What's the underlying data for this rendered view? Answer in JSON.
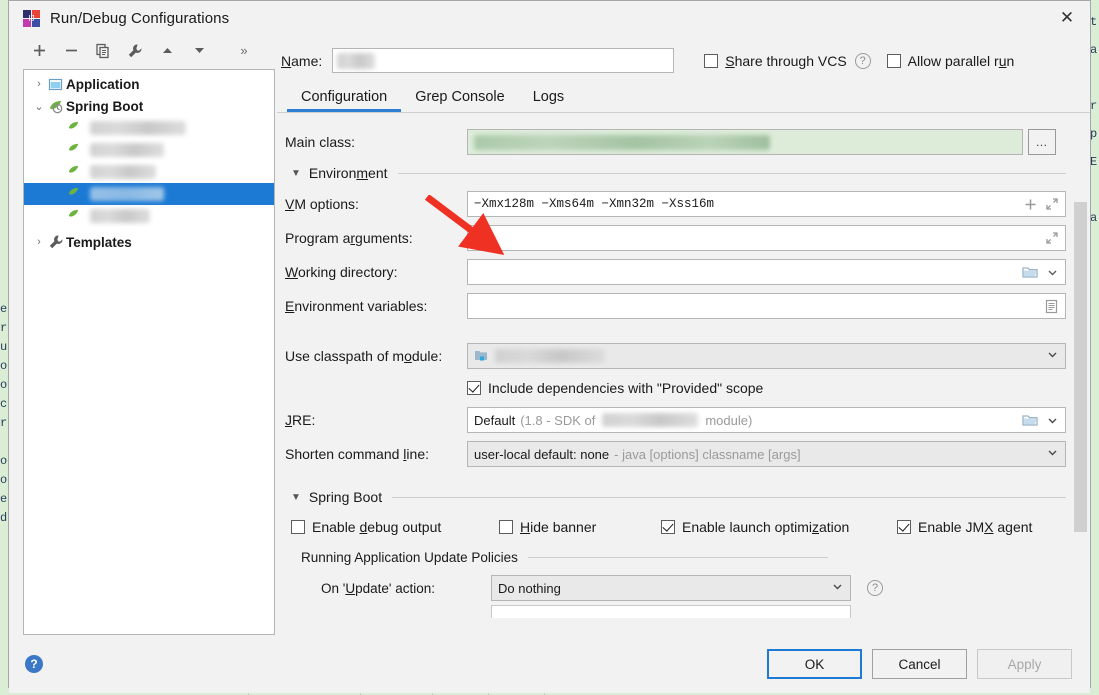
{
  "window": {
    "title": "Run/Debug Configurations",
    "app_icon": "intellij-idea-icon",
    "close_label": "✕"
  },
  "toolbar": {
    "add_label": "+",
    "remove_label": "−",
    "copy_label": "copy-icon",
    "edit_templates_label": "wrench-icon",
    "move_up_label": "▲",
    "move_down_label": "▼",
    "more_label": "»"
  },
  "tree": {
    "groups": [
      {
        "label": "Application",
        "icon": "application-icon",
        "expanded": false,
        "twisty": "›"
      },
      {
        "label": "Spring Boot",
        "icon": "spring-boot-icon",
        "expanded": true,
        "twisty": "⌄"
      },
      {
        "label": "Templates",
        "icon": "wrench-icon",
        "expanded": false,
        "twisty": "›"
      }
    ],
    "children": [
      {
        "redacted": true,
        "selected": false
      },
      {
        "redacted": true,
        "selected": false
      },
      {
        "redacted": true,
        "selected": false
      },
      {
        "redacted": true,
        "selected": true
      },
      {
        "redacted": true,
        "selected": false
      }
    ],
    "selected_index": 3
  },
  "name": {
    "label": "Name:",
    "label_mnemonic": "N",
    "value": "",
    "redacted": true
  },
  "options": {
    "share_vcs_label": "Share through VCS",
    "share_vcs_mnemonic": "S",
    "share_vcs_checked": false,
    "share_vcs_help": "?",
    "allow_parallel_label": "Allow parallel run",
    "allow_parallel_mnemonic": "u",
    "allow_parallel_checked": false
  },
  "tabs": [
    {
      "label": "Configuration",
      "active": true
    },
    {
      "label": "Grep Console",
      "active": false
    },
    {
      "label": "Logs",
      "active": false
    }
  ],
  "form": {
    "main_class": {
      "label": "Main class:",
      "value": "",
      "redacted": true,
      "browse_label": "…"
    },
    "environment_section": {
      "label": "Environment",
      "mnemonic": "m",
      "expanded": true,
      "triangle": "▼"
    },
    "vm_options": {
      "label": "VM options:",
      "mnemonic": "V",
      "value": "−Xmx128m −Xms64m −Xmn32m −Xss16m",
      "add_icon": "plus-icon",
      "expand_icon": "expand-icon"
    },
    "program_arguments": {
      "label": "Program arguments:",
      "mnemonic": "r",
      "value": "",
      "expand_icon": "expand-icon"
    },
    "working_directory": {
      "label": "Working directory:",
      "mnemonic": "W",
      "value": "",
      "browse_icon": "folder-icon",
      "dropdown_icon": "chevron-down-icon"
    },
    "environment_variables": {
      "label": "Environment variables:",
      "mnemonic": "E",
      "value": "",
      "list_icon": "list-icon"
    },
    "classpath_module": {
      "label": "Use classpath of module:",
      "mnemonic": "o",
      "value": "",
      "redacted": true,
      "module_icon": "module-icon",
      "dropdown_icon": "chevron-down-icon"
    },
    "include_provided": {
      "label": "Include dependencies with \"Provided\" scope",
      "checked": true
    },
    "jre": {
      "label": "JRE:",
      "mnemonic": "J",
      "value_strong": "Default",
      "value_detail_prefix": "(1.8 - SDK of",
      "value_detail_suffix": "module)",
      "redacted": true,
      "browse_icon": "folder-icon",
      "dropdown_icon": "chevron-down-icon"
    },
    "shorten_command_line": {
      "label": "Shorten command line:",
      "mnemonic": "l",
      "value_strong": "user-local default: none",
      "value_muted": "- java [options] classname [args]",
      "dropdown_icon": "chevron-down-icon"
    },
    "spring_boot_section": {
      "label": "Spring Boot",
      "mnemonic": "g",
      "expanded": true,
      "triangle": "▼"
    },
    "spring_boot_checks": [
      {
        "label": "Enable debug output",
        "mnemonic": "d",
        "checked": false
      },
      {
        "label": "Hide banner",
        "mnemonic": "H",
        "checked": false
      },
      {
        "label": "Enable launch optimization",
        "mnemonic": "z",
        "checked": true
      },
      {
        "label": "Enable JMX agent",
        "mnemonic": "X",
        "checked": true
      }
    ],
    "update_policies_section": {
      "label": "Running Application Update Policies"
    },
    "on_update_action": {
      "label": "On 'Update' action:",
      "mnemonic": "U",
      "value": "Do nothing",
      "dropdown_icon": "chevron-down-icon",
      "help": "?"
    }
  },
  "footer": {
    "help_label": "?",
    "ok_label": "OK",
    "cancel_label": "Cancel",
    "apply_label": "Apply",
    "apply_disabled": true,
    "ok_is_default": true
  },
  "annotation": {
    "arrow_color": "#ef3124",
    "points_to": "vm-options-field"
  },
  "colors": {
    "accent_blue": "#1c7ad4",
    "selection_blue": "#1c7ad4",
    "tab_underline": "#2d7fd3",
    "valid_field_green": "#dcecd9",
    "dialog_bg": "#f2f2f2",
    "background_editor": "#d9eed5",
    "annotation_red": "#ef3124"
  },
  "background_editor": {
    "left_column_text": "e\nrd\nu\no\nov\nc\nr\n\no\no\ne\ndH",
    "right_column_text": "t\na\n\nr\np\nE\n\na"
  }
}
